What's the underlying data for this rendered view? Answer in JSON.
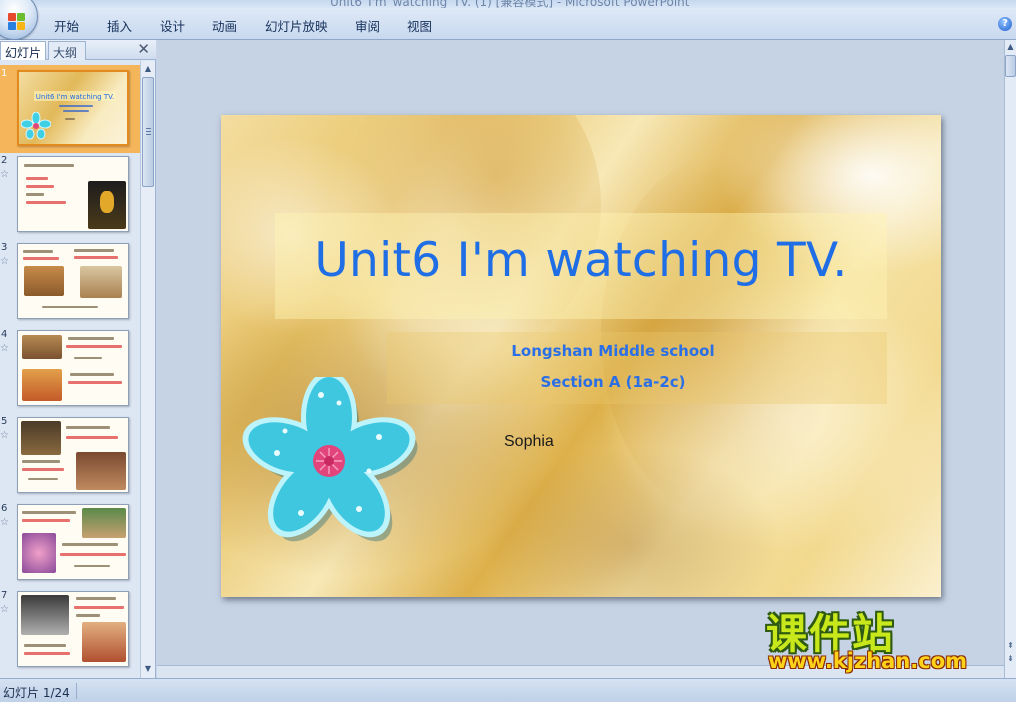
{
  "window": {
    "title": "Unit6_I'm_watching_TV. (1) [兼容模式] - Microsoft PowerPoint"
  },
  "ribbon": {
    "tabs": [
      "开始",
      "插入",
      "设计",
      "动画",
      "幻灯片放映",
      "审阅",
      "视图"
    ]
  },
  "panel": {
    "tab_slides": "幻灯片",
    "tab_outline": "大纲",
    "close": "✕"
  },
  "thumbnails": [
    {
      "num": "1",
      "selected": true
    },
    {
      "num": "2",
      "selected": false
    },
    {
      "num": "3",
      "selected": false
    },
    {
      "num": "4",
      "selected": false
    },
    {
      "num": "5",
      "selected": false
    },
    {
      "num": "6",
      "selected": false
    },
    {
      "num": "7",
      "selected": false
    }
  ],
  "slide": {
    "title": "Unit6 I'm watching TV.",
    "subtitle1": "Longshan Middle school",
    "subtitle2": "Section A (1a-2c)",
    "author": "Sophia"
  },
  "watermark": {
    "chinese": "课件站",
    "url": "www.kjzhan.com"
  },
  "status": {
    "slide_counter": "幻灯片 1/24"
  },
  "colors": {
    "title_blue": "#1f6ee6",
    "selection_orange": "#f5b55b",
    "flower_cyan": "#3fd0e6",
    "flower_center": "#e2457c"
  }
}
